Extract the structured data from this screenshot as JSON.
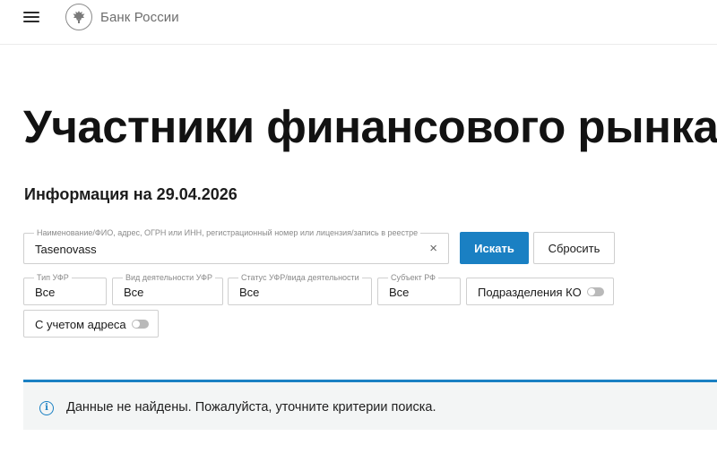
{
  "header": {
    "menu_icon": "hamburger-menu-icon",
    "logo_icon": "double-headed-eagle-emblem-icon",
    "logo_text": "Банк России"
  },
  "page": {
    "title": "Участники финансового рынка",
    "info_date": "Информация на 29.04.2026"
  },
  "search": {
    "label": "Наименование/ФИО, адрес, ОГРН или ИНН, регистрационный номер или лицензия/запись в реестре",
    "value": "Tasenovass",
    "clear_glyph": "×",
    "search_button": "Искать",
    "reset_button": "Сбросить"
  },
  "filters": [
    {
      "label": "Тип УФР",
      "value": "Все"
    },
    {
      "label": "Вид деятельности УФР",
      "value": "Все"
    },
    {
      "label": "Статус УФР/вида деятельности",
      "value": "Все"
    },
    {
      "label": "Субъект РФ",
      "value": "Все"
    }
  ],
  "toggles": [
    {
      "label": "Подразделения КО",
      "checked": false
    },
    {
      "label": "С учетом адреса",
      "checked": false
    }
  ],
  "notice": {
    "icon": "info-icon",
    "text": "Данные не найдены. Пожалуйста, уточните критерии поиска."
  },
  "colors": {
    "accent": "#1a80c3",
    "notice_bg": "#f3f5f5",
    "border": "#cfcfcf"
  }
}
